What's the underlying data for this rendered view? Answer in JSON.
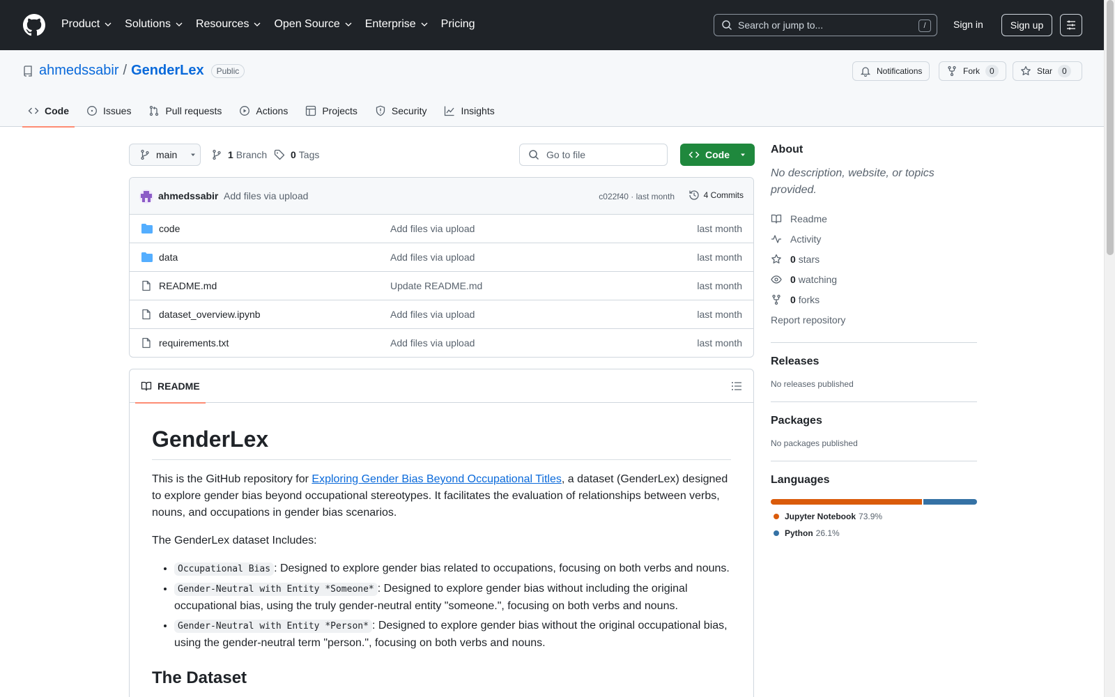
{
  "header": {
    "nav": [
      "Product",
      "Solutions",
      "Resources",
      "Open Source",
      "Enterprise",
      "Pricing"
    ],
    "search_placeholder": "Search or jump to...",
    "search_shortcut": "/",
    "signin": "Sign in",
    "signup": "Sign up"
  },
  "repo": {
    "owner": "ahmedssabir",
    "separator": "/",
    "name": "GenderLex",
    "visibility": "Public",
    "notifications": "Notifications",
    "fork_label": "Fork",
    "fork_count": "0",
    "star_label": "Star",
    "star_count": "0"
  },
  "tabs": [
    "Code",
    "Issues",
    "Pull requests",
    "Actions",
    "Projects",
    "Security",
    "Insights"
  ],
  "branchbar": {
    "branch": "main",
    "branches_count": "1",
    "branches_label": "Branch",
    "tags_count": "0",
    "tags_label": "Tags",
    "goto_placeholder": "Go to file",
    "code_label": "Code"
  },
  "commit": {
    "author": "ahmedssabir",
    "message": "Add files via upload",
    "meta": "c022f40 · last month",
    "commits": "4 Commits"
  },
  "files": [
    {
      "type": "folder",
      "name": "code",
      "message": "Add files via upload",
      "date": "last month"
    },
    {
      "type": "folder",
      "name": "data",
      "message": "Add files via upload",
      "date": "last month"
    },
    {
      "type": "file",
      "name": "README.md",
      "message": "Update README.md",
      "date": "last month"
    },
    {
      "type": "file",
      "name": "dataset_overview.ipynb",
      "message": "Add files via upload",
      "date": "last month"
    },
    {
      "type": "file",
      "name": "requirements.txt",
      "message": "Add files via upload",
      "date": "last month"
    }
  ],
  "readme": {
    "tab": "README",
    "title": "GenderLex",
    "intro_before": "This is the GitHub repository for ",
    "intro_link": "Exploring Gender Bias Beyond Occupational Titles",
    "intro_after": ", a dataset (GenderLex) designed to explore gender bias beyond occupational stereotypes. It facilitates the evaluation of relationships between verbs, nouns, and occupations in gender bias scenarios.",
    "includes": "The GenderLex dataset Includes:",
    "items": [
      {
        "code": "Occupational Bias",
        "text": ": Designed to explore gender bias related to occupations, focusing on both verbs and nouns."
      },
      {
        "code": "Gender-Neutral with Entity *Someone*",
        "text": ": Designed to explore gender bias without including the original occupational bias, using the truly gender-neutral entity \"someone.\", focusing on both verbs and nouns."
      },
      {
        "code": "Gender-Neutral with Entity *Person*",
        "text": ": Designed to explore gender bias without the original occupational bias, using the gender-neutral term \"person.\", focusing on both verbs and nouns."
      }
    ],
    "next_heading": "The Dataset"
  },
  "about": {
    "title": "About",
    "description": "No description, website, or topics provided.",
    "readme": "Readme",
    "activity": "Activity",
    "stars_count": "0",
    "stars_label": "stars",
    "watching_count": "0",
    "watching_label": "watching",
    "forks_count": "0",
    "forks_label": "forks",
    "report": "Report repository"
  },
  "releases": {
    "title": "Releases",
    "empty": "No releases published"
  },
  "packages": {
    "title": "Packages",
    "empty": "No packages published"
  },
  "languages": {
    "title": "Languages",
    "items": [
      {
        "name": "Jupyter Notebook",
        "percent": "73.9%",
        "value": 73.9,
        "color": "#DA5B0B"
      },
      {
        "name": "Python",
        "percent": "26.1%",
        "value": 26.1,
        "color": "#3572A5"
      }
    ]
  },
  "colors": {
    "accent": "#0969da",
    "primary_button": "#1f883d",
    "tab_underline": "#fd8c73",
    "header_bg": "#1f2328"
  }
}
